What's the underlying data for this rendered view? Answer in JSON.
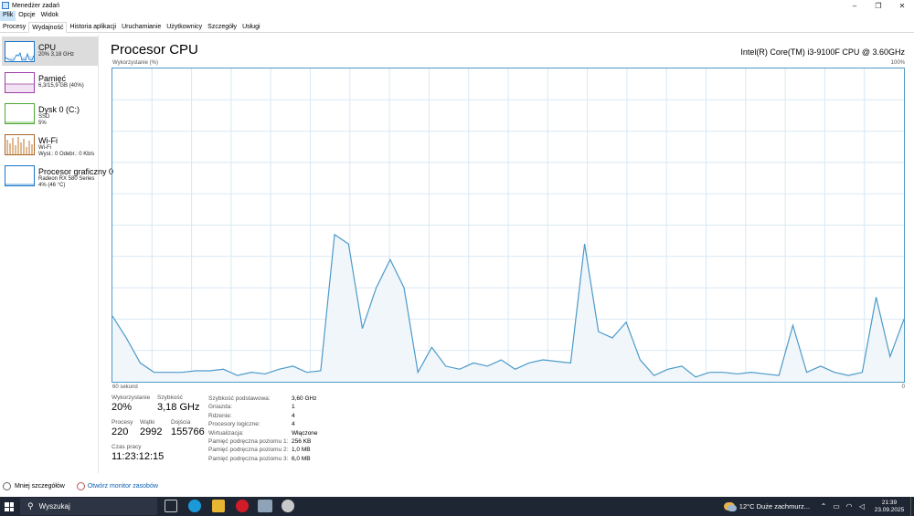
{
  "window": {
    "title": "Menedżer zadań",
    "minimize": "–",
    "maximize": "❐",
    "close": "✕"
  },
  "menu": [
    "Plik",
    "Opcje",
    "Widok"
  ],
  "tabs": [
    "Procesy",
    "Wydajność",
    "Historia aplikacji",
    "Uruchamianie",
    "Użytkownicy",
    "Szczegóły",
    "Usługi"
  ],
  "sidebar": [
    {
      "title": "CPU",
      "sub1": "20% 3,18 GHz",
      "sub2": "",
      "sub3": "",
      "color": "#1a76c9"
    },
    {
      "title": "Pamięć",
      "sub1": "6,3/15,9 GB (40%)",
      "sub2": "",
      "sub3": "",
      "color": "#9b3fa3"
    },
    {
      "title": "Dysk 0 (C:)",
      "sub1": "SSD",
      "sub2": "5%",
      "sub3": "",
      "color": "#4da832"
    },
    {
      "title": "Wi-Fi",
      "sub1": "Wi-Fi",
      "sub2": "Wysł.: 0 Odebr.: 0 Kb/s",
      "sub3": "",
      "color": "#a7652a"
    },
    {
      "title": "Procesor graficzny 0",
      "sub1": "Radeon RX 580 Series",
      "sub2": "4% (46 °C)",
      "sub3": "",
      "color": "#1a76c9"
    }
  ],
  "main": {
    "title": "Procesor CPU",
    "model": "Intel(R) Core(TM) i3-9100F CPU @ 3.60GHz",
    "graph_label": "Wykorzystanie (%)",
    "graph_max": "100%",
    "graph_time": "60 sekund",
    "graph_min": "0"
  },
  "stats": {
    "utilization_label": "Wykorzystanie",
    "utilization": "20%",
    "speed_label": "Szybkość",
    "speed": "3,18 GHz",
    "processes_label": "Procesy",
    "processes": "220",
    "threads_label": "Wątki",
    "threads": "2992",
    "handles_label": "Dojścia",
    "handles": "155766",
    "uptime_label": "Czas pracy",
    "uptime": "11:23:12:15"
  },
  "properties": [
    {
      "k": "Szybkość podstawowa:",
      "v": "3,60 GHz"
    },
    {
      "k": "Gniazda:",
      "v": "1"
    },
    {
      "k": "Rdzenie:",
      "v": "4"
    },
    {
      "k": "Procesory logiczne:",
      "v": "4"
    },
    {
      "k": "Wirtualizacja:",
      "v": "Włączone"
    },
    {
      "k": "Pamięć podręczna poziomu 1:",
      "v": "256 KB"
    },
    {
      "k": "Pamięć podręczna poziomu 2:",
      "v": "1,0 MB"
    },
    {
      "k": "Pamięć podręczna poziomu 3:",
      "v": "6,0 MB"
    }
  ],
  "footer": {
    "less_details": "Mniej szczegółów",
    "open_monitor": "Otwórz monitor zasobów"
  },
  "taskbar": {
    "search_placeholder": "Wyszukaj",
    "weather": "12°C  Duże zachmurz...",
    "time": "21:39",
    "date": "23.09.2025"
  },
  "colors": {
    "accent": "#1a76c9",
    "graph_line": "#4c9ac8",
    "graph_fill": "#f1f6fb",
    "grid": "#d9e8f3"
  },
  "cpu_history": [
    21,
    14,
    6,
    3,
    3,
    3,
    3.5,
    3.5,
    4,
    2,
    3,
    2.5,
    4,
    5,
    3,
    3.5,
    47,
    44,
    17,
    30,
    39,
    30,
    3,
    11,
    5,
    4,
    6,
    5,
    7,
    4,
    6,
    7,
    6.5,
    6,
    44,
    16,
    14,
    19,
    7,
    2,
    4,
    5,
    1.5,
    3,
    3,
    2.5,
    3,
    2.5,
    2,
    18,
    3,
    5,
    3,
    2,
    3,
    27,
    8,
    20
  ]
}
